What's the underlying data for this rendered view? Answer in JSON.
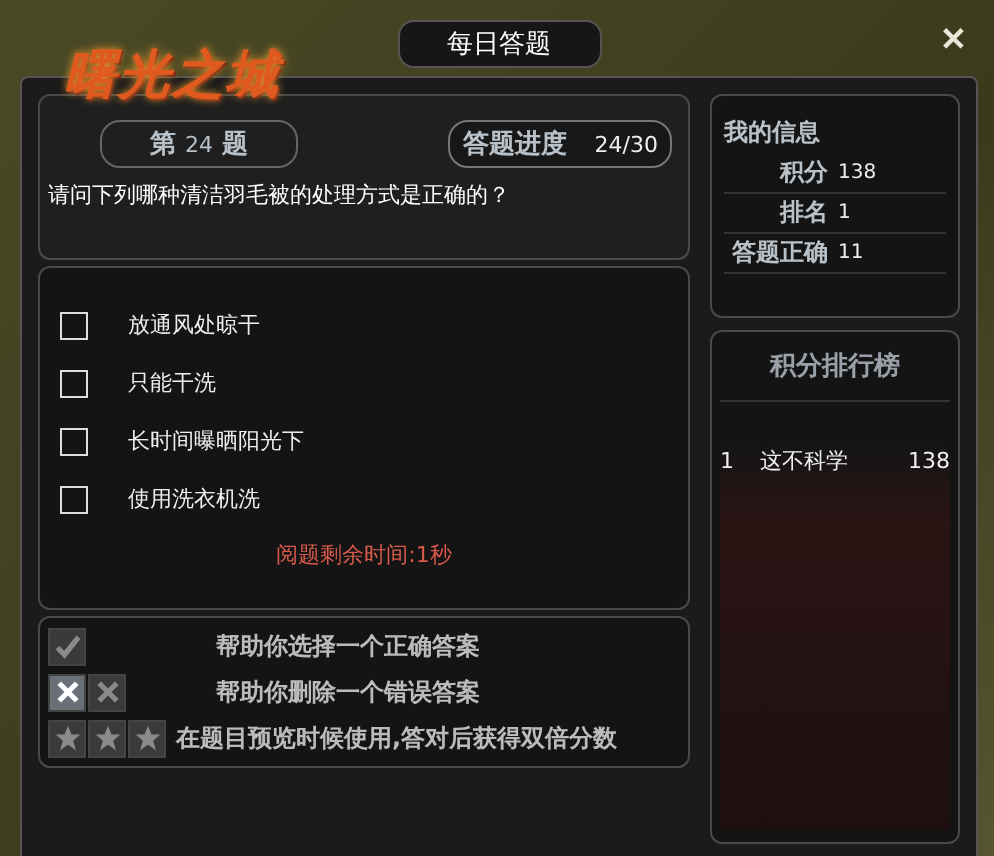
{
  "logo": "曙光之城",
  "window": {
    "title": "每日答题",
    "close": "✕"
  },
  "question": {
    "number_prefix": "第",
    "number": "24",
    "number_suffix": "题",
    "progress_label": "答题进度",
    "progress": "24/30",
    "text": "请问下列哪种清洁羽毛被的处理方式是正确的？"
  },
  "options": [
    {
      "label": "放通风处晾干",
      "checked": false
    },
    {
      "label": "只能干洗",
      "checked": false
    },
    {
      "label": "长时间曝晒阳光下",
      "checked": false
    },
    {
      "label": "使用洗衣机洗",
      "checked": false
    }
  ],
  "timer": "阅题剩余时间:1秒",
  "helpers": [
    {
      "icons": [
        {
          "kind": "check",
          "dimmed": true
        }
      ],
      "text": "帮助你选择一个正确答案"
    },
    {
      "icons": [
        {
          "kind": "cross",
          "dimmed": false
        },
        {
          "kind": "cross",
          "dimmed": true
        }
      ],
      "text": "帮助你删除一个错误答案"
    },
    {
      "icons": [
        {
          "kind": "star",
          "dimmed": true
        },
        {
          "kind": "star",
          "dimmed": true
        },
        {
          "kind": "star",
          "dimmed": true
        }
      ],
      "text": "在题目预览时候使用,答对后获得双倍分数"
    }
  ],
  "my_info": {
    "title": "我的信息",
    "rows": [
      {
        "label": "积分",
        "value": "138"
      },
      {
        "label": "排名",
        "value": "1"
      },
      {
        "label": "答题正确",
        "value": "11"
      }
    ]
  },
  "ranking": {
    "title": "积分排行榜",
    "rows": [
      {
        "rank": "1",
        "name": "这不科学",
        "score": "138"
      }
    ]
  }
}
